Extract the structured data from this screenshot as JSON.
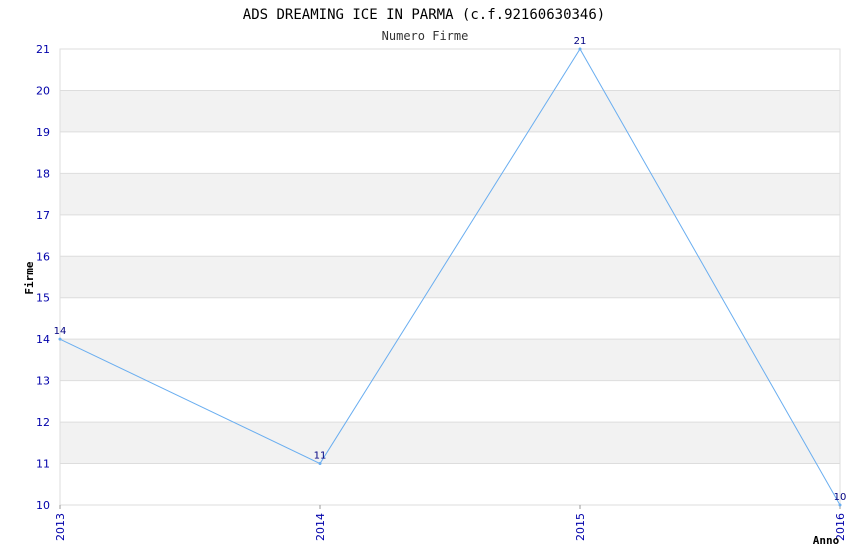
{
  "chart_data": {
    "type": "line",
    "title": "ADS DREAMING ICE IN PARMA (c.f.92160630346)",
    "subtitle": "Numero Firme",
    "xlabel": "Anno",
    "ylabel": "Firme",
    "categories": [
      "2013",
      "2014",
      "2015",
      "2016"
    ],
    "series": [
      {
        "values": [
          14,
          11,
          21,
          10
        ]
      }
    ],
    "ylim": [
      10,
      21
    ],
    "yticks": [
      10,
      11,
      12,
      13,
      14,
      15,
      16,
      17,
      18,
      19,
      20,
      21
    ],
    "grid": true,
    "colors": {
      "line": "#6aaef0",
      "tick_text": "#0000aa",
      "data_label": "#000080",
      "band": "#f2f2f2",
      "grid": "#dddddd"
    }
  }
}
